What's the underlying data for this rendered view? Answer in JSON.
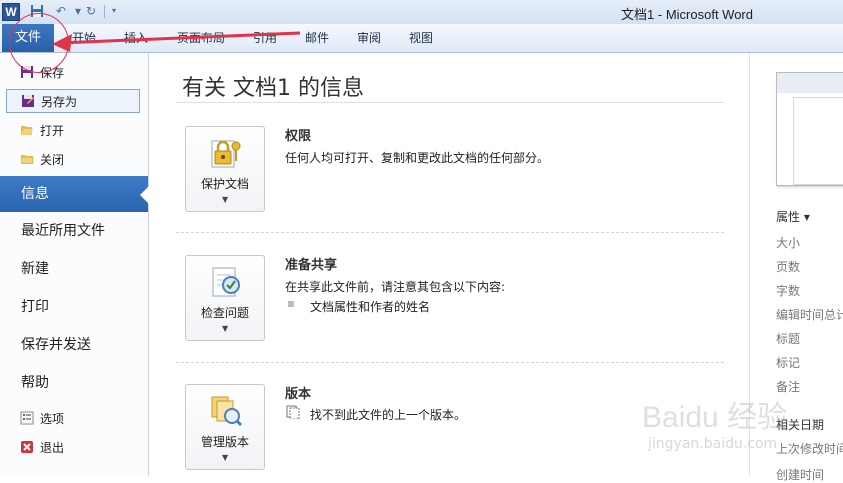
{
  "window": {
    "app_icon_letter": "W",
    "title": "文档1 - Microsoft Word"
  },
  "ribbon": {
    "file_tab": "文件",
    "tabs": [
      "开始",
      "插入",
      "页面布局",
      "引用",
      "邮件",
      "审阅",
      "视图"
    ]
  },
  "nav": {
    "small_items": [
      "保存",
      "另存为",
      "打开",
      "关闭"
    ],
    "big_items": [
      "信息",
      "最近所用文件",
      "新建",
      "打印",
      "保存并发送",
      "帮助"
    ],
    "bottom_items": [
      "选项",
      "退出"
    ],
    "selected": "信息"
  },
  "main": {
    "title": "有关 文档1 的信息",
    "sections": [
      {
        "button_label": "保护文档",
        "heading": "权限",
        "text": "任何人均可打开、复制和更改此文档的任何部分。",
        "icon": "lock-key-icon"
      },
      {
        "button_label": "检查问题",
        "heading": "准备共享",
        "text": "在共享此文件前，请注意其包含以下内容:",
        "bullets": [
          "文档属性和作者的姓名"
        ],
        "icon": "checklist-icon"
      },
      {
        "button_label": "管理版本",
        "heading": "版本",
        "text": "找不到此文件的上一个版本。",
        "icon": "versions-icon"
      }
    ]
  },
  "properties": {
    "heading": "属性 ▾",
    "items": [
      "大小",
      "页数",
      "字数",
      "编辑时间总计",
      "标题",
      "标记",
      "备注"
    ],
    "related_heading": "相关日期",
    "related_items": [
      "上次修改时间",
      "创建时间"
    ]
  },
  "annotation": {
    "color": "#e0344a"
  },
  "watermark": {
    "text": "Baidu 经验",
    "sub": "jingyan.baidu.com"
  },
  "colors": {
    "accent": "#2a63b0"
  }
}
